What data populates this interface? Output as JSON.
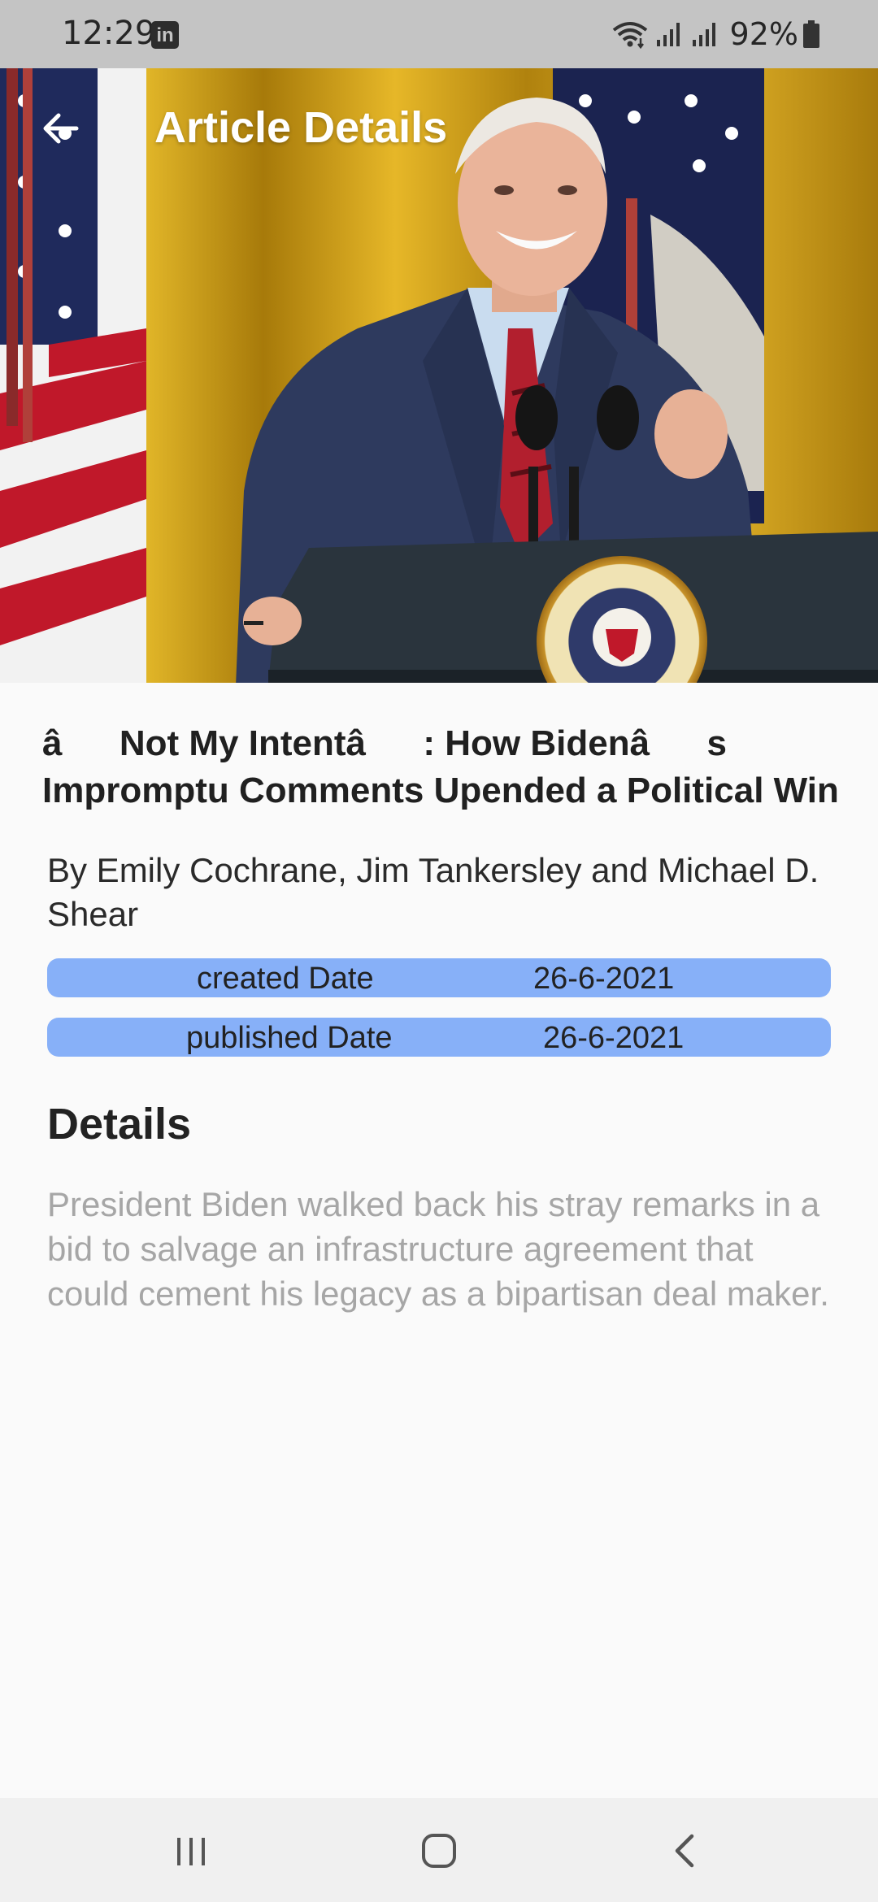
{
  "status_bar": {
    "time": "12:29",
    "notification_icon": "linkedin-icon",
    "battery_percent": "92%"
  },
  "app_bar": {
    "title": "Article Details",
    "back_icon": "arrow-left-icon"
  },
  "article": {
    "title_line1": "âNot My Intentâ: How Bidenâs",
    "title_line2": "Impromptu Comments Upended a Political Win",
    "authors": "By Emily Cochrane, Jim Tankersley and Michael D. Shear",
    "created": {
      "label": "created Date",
      "value": "26-6-2021"
    },
    "published": {
      "label": "published Date",
      "value": "26-6-2021"
    },
    "details_heading": "Details",
    "details_body": "President Biden walked back his stray remarks in a bid to salvage an infrastructure agreement that could cement his legacy as a bipartisan deal maker."
  },
  "nav_bar": {
    "icons": [
      "recent-apps-icon",
      "home-icon",
      "back-icon"
    ]
  },
  "colors": {
    "date_pill": "#87b0f8",
    "status_bar": "#c4c4c4",
    "details_text": "#a6a6a6"
  }
}
